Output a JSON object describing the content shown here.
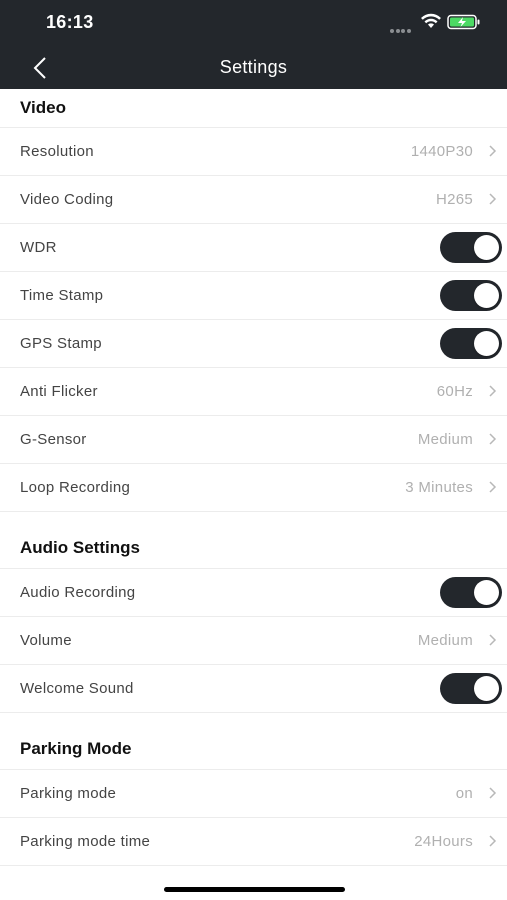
{
  "status_bar": {
    "time": "16:13"
  },
  "header": {
    "title": "Settings"
  },
  "sections": [
    {
      "title": "Video",
      "rows": [
        {
          "label": "Resolution",
          "value": "1440P30",
          "type": "select"
        },
        {
          "label": "Video Coding",
          "value": "H265",
          "type": "select"
        },
        {
          "label": "WDR",
          "type": "toggle",
          "on": true
        },
        {
          "label": "Time Stamp",
          "type": "toggle",
          "on": true
        },
        {
          "label": "GPS Stamp",
          "type": "toggle",
          "on": true
        },
        {
          "label": "Anti Flicker",
          "value": "60Hz",
          "type": "select"
        },
        {
          "label": "G-Sensor",
          "value": "Medium",
          "type": "select"
        },
        {
          "label": "Loop Recording",
          "value": "3 Minutes",
          "type": "select"
        }
      ]
    },
    {
      "title": "Audio Settings",
      "rows": [
        {
          "label": "Audio Recording",
          "type": "toggle",
          "on": true
        },
        {
          "label": "Volume",
          "value": "Medium",
          "type": "select"
        },
        {
          "label": "Welcome Sound",
          "type": "toggle",
          "on": true
        }
      ]
    },
    {
      "title": "Parking Mode",
      "rows": [
        {
          "label": "Parking mode",
          "value": "on",
          "type": "select"
        },
        {
          "label": "Parking mode time",
          "value": "24Hours",
          "type": "select"
        }
      ]
    }
  ],
  "colors": {
    "header_bg": "#23272c",
    "toggle_on": "#23272c",
    "value_text": "#b0b0b0"
  },
  "icons": {
    "back": "chevron-left-icon",
    "row_arrow": "chevron-right-icon",
    "wifi": "wifi-icon",
    "battery": "battery-charging-icon"
  }
}
